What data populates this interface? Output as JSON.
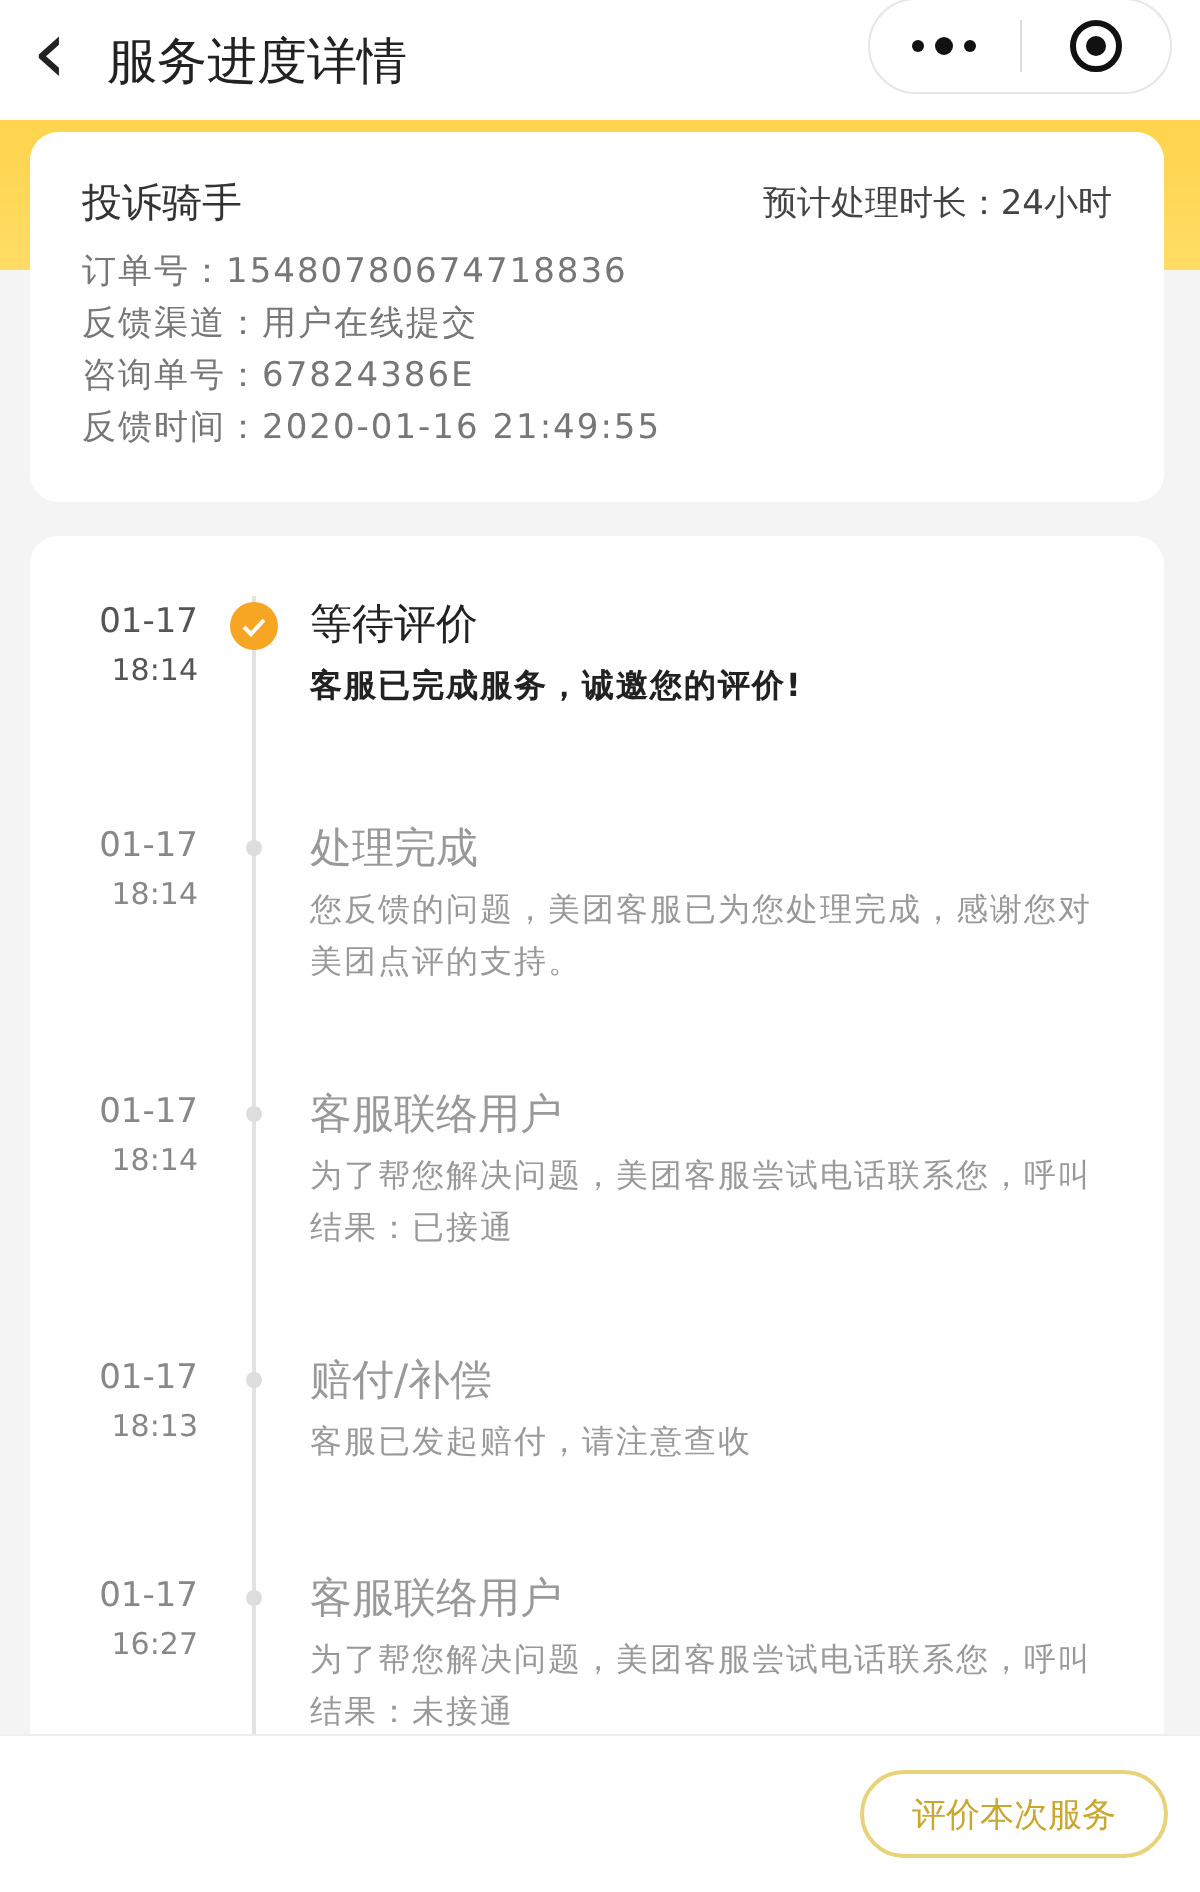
{
  "header": {
    "back_icon": "‹",
    "title": "服务进度详情"
  },
  "summary": {
    "type": "投诉骑手",
    "estimate": "预计处理时长：24小时",
    "fields": [
      {
        "label": "订单号：",
        "value": "15480780674718836"
      },
      {
        "label": "反馈渠道：",
        "value": "用户在线提交"
      },
      {
        "label": "咨询单号：",
        "value": "67824386E"
      },
      {
        "label": "反馈时间：",
        "value": "2020-01-16 21:49:55"
      }
    ]
  },
  "timeline": [
    {
      "date": "01-17",
      "time": "18:14",
      "title": "等待评价",
      "description": "客服已完成服务，诚邀您的评价!",
      "active": true
    },
    {
      "date": "01-17",
      "time": "18:14",
      "title": "处理完成",
      "description": "您反馈的问题，美团客服已为您处理完成，感谢您对美团点评的支持。",
      "active": false
    },
    {
      "date": "01-17",
      "time": "18:14",
      "title": "客服联络用户",
      "description": "为了帮您解决问题，美团客服尝试电话联系您，呼叫结果：已接通",
      "active": false
    },
    {
      "date": "01-17",
      "time": "18:13",
      "title": "赔付/补偿",
      "description": "客服已发起赔付，请注意查收",
      "active": false
    },
    {
      "date": "01-17",
      "time": "16:27",
      "title": "客服联络用户",
      "description": "为了帮您解决问题，美团客服尝试电话联系您，呼叫结果：未接通",
      "active": false
    }
  ],
  "bottom_button": "评价本次服务"
}
